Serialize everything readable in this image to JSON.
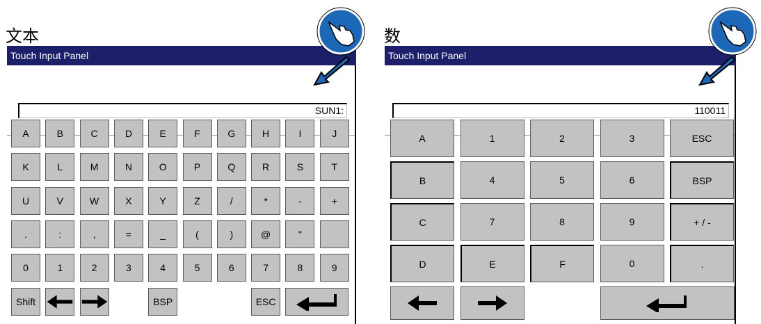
{
  "left": {
    "caption": "文本",
    "window_title": "Touch Input Panel",
    "input_value": "SUN1:",
    "keys": [
      [
        "A",
        "B",
        "C",
        "D",
        "E",
        "F",
        "G",
        "H",
        "I",
        "J"
      ],
      [
        "K",
        "L",
        "M",
        "N",
        "O",
        "P",
        "Q",
        "R",
        "S",
        "T"
      ],
      [
        "U",
        "V",
        "W",
        "X",
        "Y",
        "Z",
        "/",
        "*",
        "-",
        "+"
      ],
      [
        ".",
        ":",
        ",",
        "=",
        "_",
        "(",
        ")",
        "@",
        "\"",
        ""
      ],
      [
        "0",
        "1",
        "2",
        "3",
        "4",
        "5",
        "6",
        "7",
        "8",
        "9"
      ]
    ],
    "bottom_row": {
      "shift": "Shift",
      "left_icon": "arrow-left-icon",
      "right_icon": "arrow-right-icon",
      "bsp": "BSP",
      "esc": "ESC",
      "enter_icon": "enter-icon"
    }
  },
  "right": {
    "caption": "数",
    "window_title": "Touch Input Panel",
    "input_value": "110011",
    "keys": [
      [
        "A",
        "1",
        "2",
        "3",
        "ESC"
      ],
      [
        "B",
        "4",
        "5",
        "6",
        "BSP"
      ],
      [
        "C",
        "7",
        "8",
        "9",
        "+ / -"
      ],
      [
        "D",
        "E",
        "F",
        "0",
        "."
      ]
    ],
    "bottom_row": {
      "left_icon": "arrow-left-icon",
      "right_icon": "arrow-right-icon",
      "enter_icon": "enter-icon"
    }
  },
  "icons": {
    "hand": "touch-hand-icon",
    "pointer": "pointer-arrow-icon"
  },
  "colors": {
    "titlebar": "#1e1f6b",
    "key": "#c2c2c2",
    "hand_circle": "#1c67b7"
  }
}
